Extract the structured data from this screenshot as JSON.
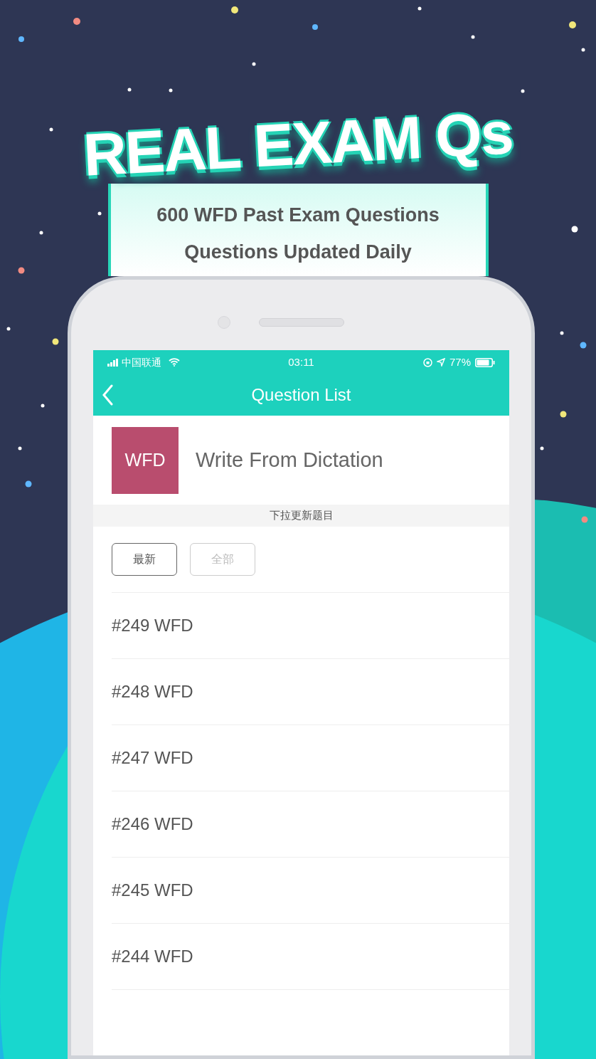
{
  "headline": "REAL EXAM Qs",
  "subtitle_lines": [
    "600 WFD Past Exam Questions",
    "Questions Updated Daily"
  ],
  "status_bar": {
    "carrier": "中国联通",
    "time": "03:11",
    "battery": "77%"
  },
  "nav": {
    "title": "Question List"
  },
  "category": {
    "badge": "WFD",
    "title": "Write From Dictation"
  },
  "pull_hint": "下拉更新题目",
  "filters": [
    {
      "label": "最新",
      "selected": true
    },
    {
      "label": "全部",
      "selected": false
    }
  ],
  "questions": [
    "#249 WFD",
    "#248 WFD",
    "#247 WFD",
    "#246 WFD",
    "#245 WFD",
    "#244 WFD"
  ]
}
